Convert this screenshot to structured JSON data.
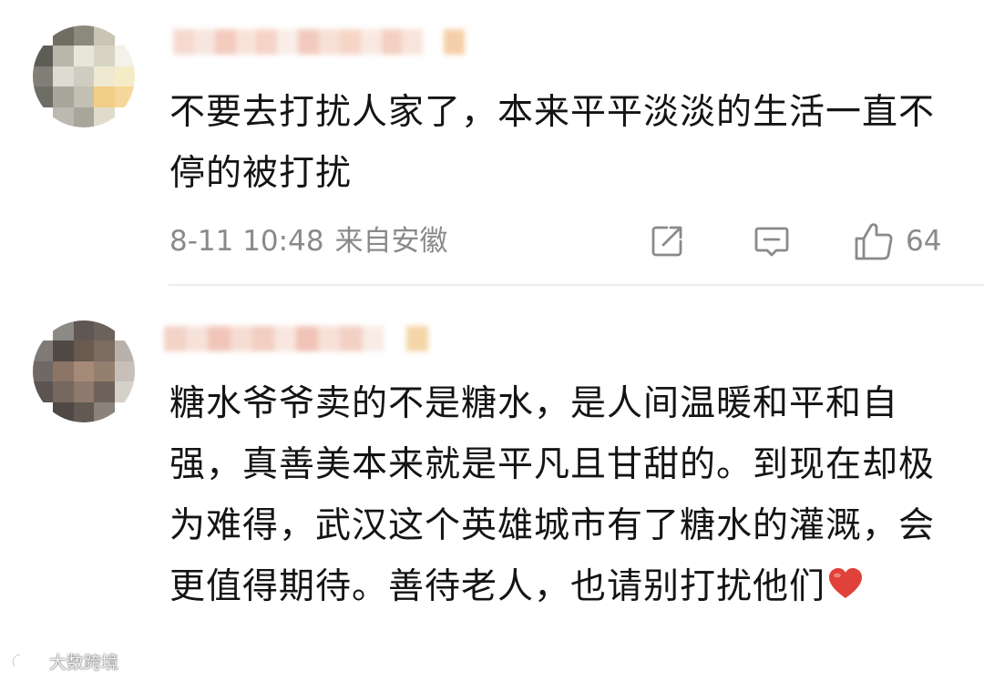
{
  "comments": [
    {
      "text": "不要去打扰人家了，本来平平淡淡的生活一直不停的被打扰",
      "time": "8-11 10:48",
      "location": "来自安徽",
      "like_count": "64"
    },
    {
      "text": "糖水爷爷卖的不是糖水，是人间温暖和平和自强，真善美本来就是平凡且甘甜的。到现在却极为难得，武汉这个英雄城市有了糖水的灌溉，会更值得期待。善待老人，也请别打扰他们"
    }
  ],
  "watermark": {
    "text": "大数跨境"
  },
  "icons": {
    "share": "share-icon",
    "reply": "comment-icon",
    "like": "thumbs-up-icon",
    "heart": "red-heart-icon",
    "watermark_logo": "brand-logo-icon"
  },
  "colors": {
    "text": "#141414",
    "meta": "#8a8a8a",
    "divider": "#ececec",
    "heart": "#e0413a"
  }
}
